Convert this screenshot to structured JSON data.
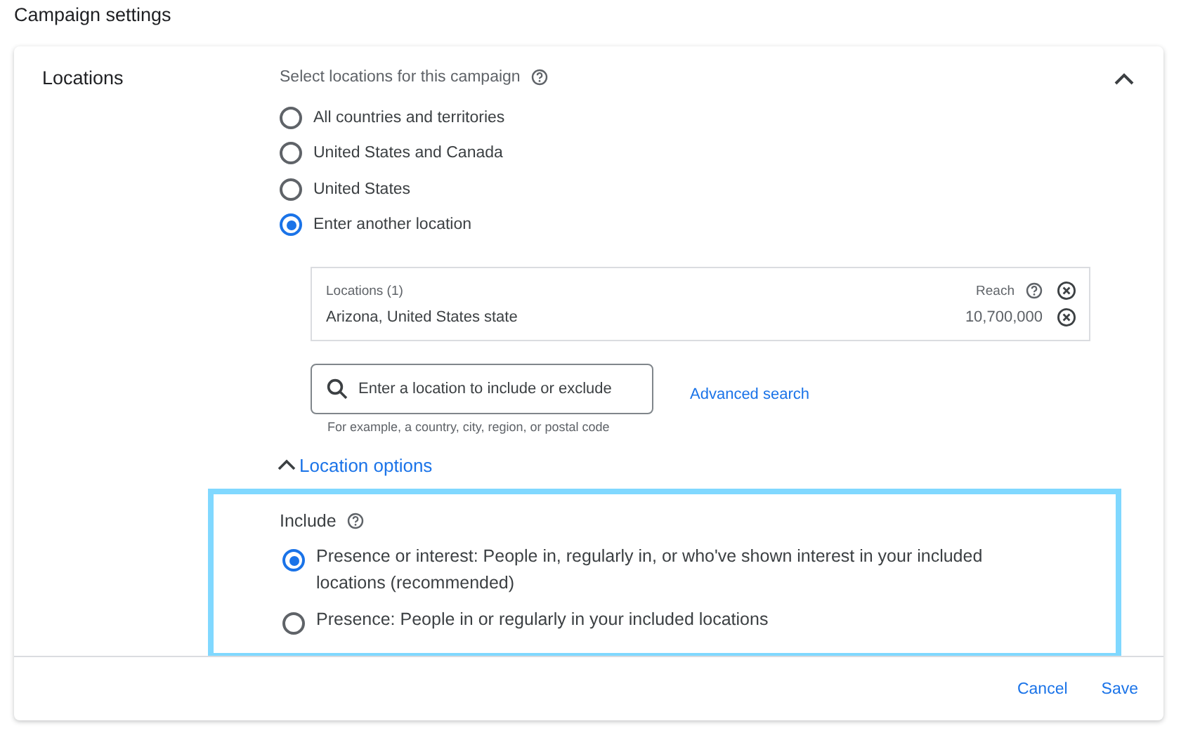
{
  "page_title": "Campaign settings",
  "section": {
    "label": "Locations",
    "expanded": true,
    "prompt": "Select locations for this campaign",
    "location_choices": [
      {
        "label": "All countries and territories",
        "selected": false
      },
      {
        "label": "United States and Canada",
        "selected": false
      },
      {
        "label": "United States",
        "selected": false
      },
      {
        "label": "Enter another location",
        "selected": true
      }
    ],
    "locations_table": {
      "heading": "Locations (1)",
      "reach_label": "Reach",
      "rows": [
        {
          "name": "Arizona, United States state",
          "reach": "10,700,000"
        }
      ]
    },
    "search": {
      "placeholder": "Enter a location to include or exclude",
      "hint": "For example, a country, city, region, or postal code"
    },
    "advanced_search": "Advanced search",
    "location_options": {
      "label": "Location options",
      "expanded": true,
      "highlighted": true,
      "include_label": "Include",
      "choices": [
        {
          "label": "Presence or interest: People in, regularly in, or who've shown interest in your included locations (recommended)",
          "selected": true
        },
        {
          "label": "Presence: People in or regularly in your included locations",
          "selected": false
        }
      ]
    }
  },
  "buttons": [
    "Cancel",
    "Save"
  ]
}
